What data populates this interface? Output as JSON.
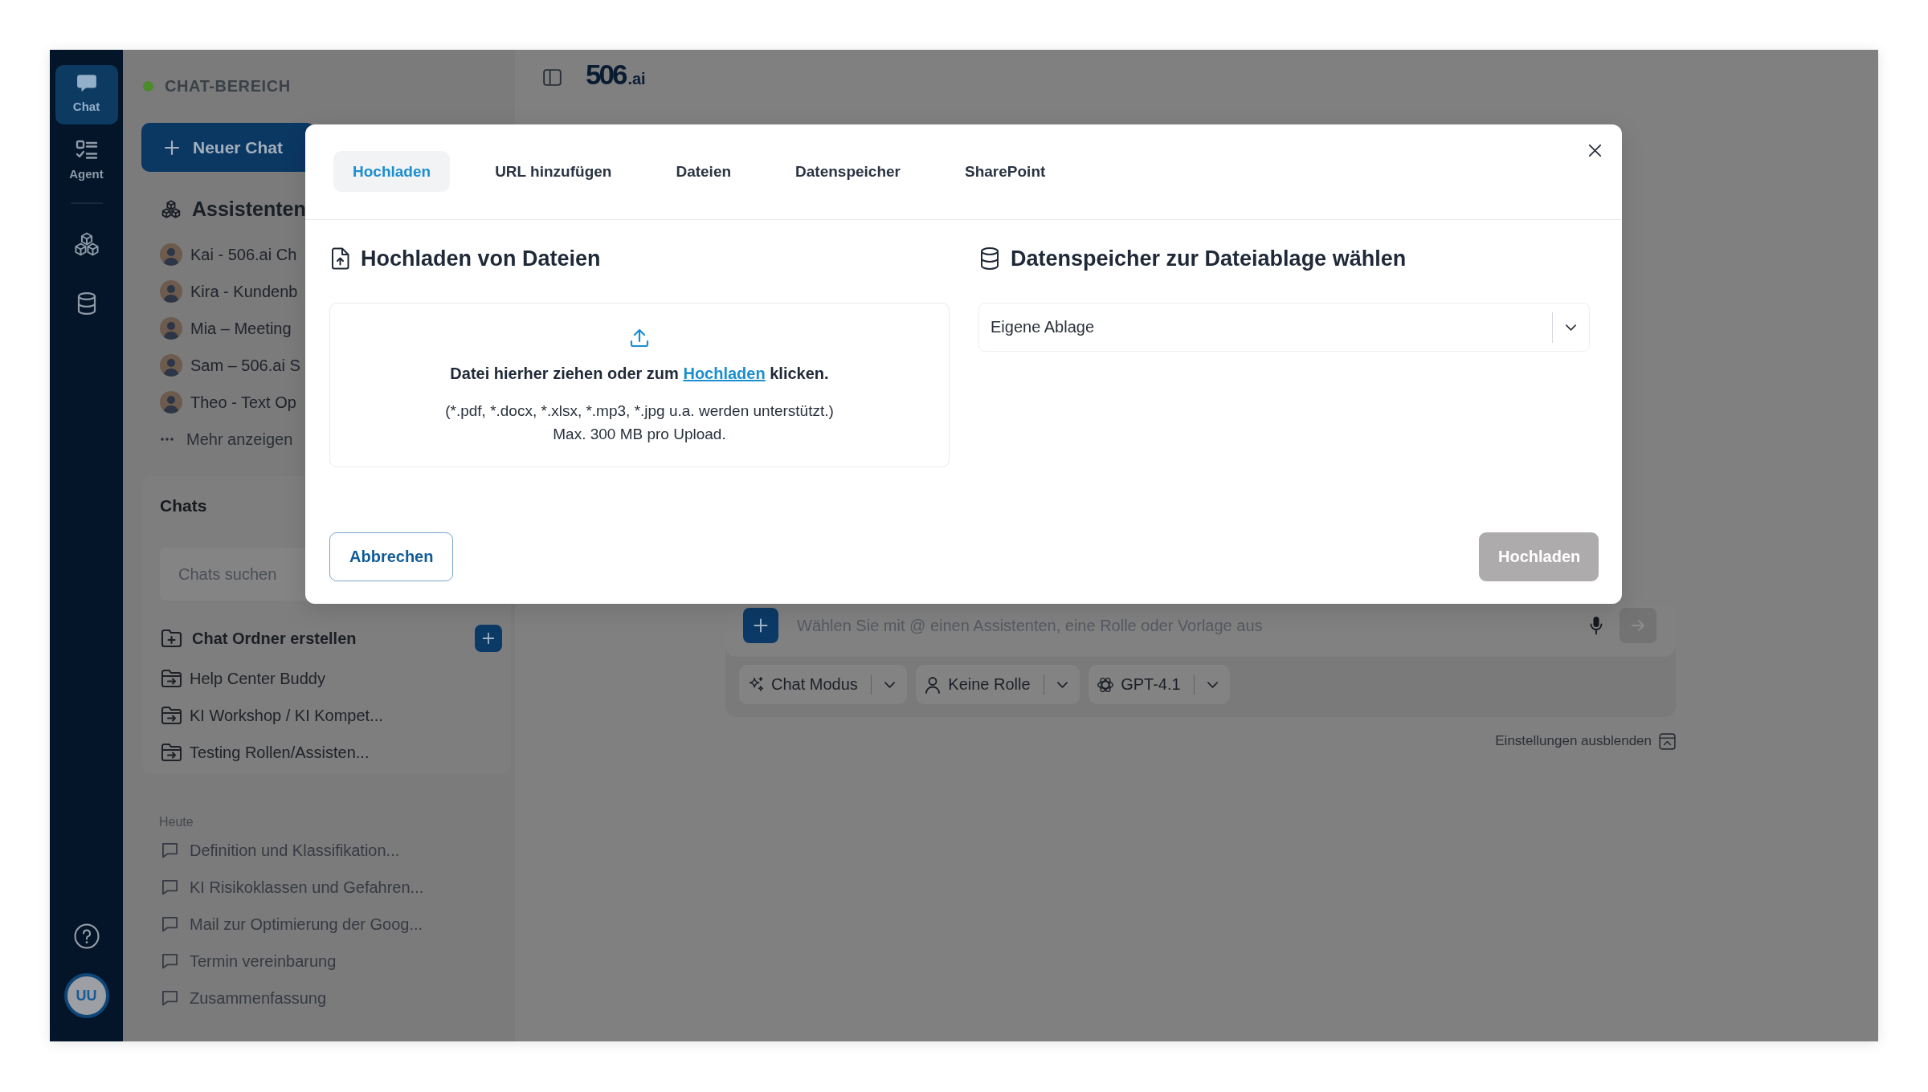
{
  "nav_rail": {
    "items": [
      {
        "kind": "chat",
        "label": "Chat",
        "selected": true
      },
      {
        "kind": "agent",
        "label": "Agent",
        "selected": false
      },
      {
        "kind": "cubes",
        "selected": false
      },
      {
        "kind": "database",
        "selected": false
      }
    ],
    "user_initials": "UU"
  },
  "sidebar": {
    "section_title": "CHAT-BEREICH",
    "new_chat": "Neuer Chat",
    "assistants": {
      "title": "Assistenten",
      "items": [
        "Kai - 506.ai Ch",
        "Kira - Kundenb",
        "Mia – Meeting",
        "Sam – 506.ai S",
        "Theo - Text Op"
      ],
      "more": "Mehr anzeigen"
    },
    "chats": {
      "title": "Chats",
      "search": {
        "placeholder": "Chats suchen"
      },
      "create_folder": "Chat Ordner erstellen",
      "folders": [
        "Help Center Buddy",
        "KI Workshop / KI Kompet...",
        "Testing Rollen/Assisten..."
      ]
    },
    "history": [
      {
        "label": "Heute",
        "items": [
          "Definition und Klassifikation...",
          "KI Risikoklassen und Gefahren...",
          "Mail zur Optimierung der Goog...",
          "Termin vereinbarung",
          "Zusammenfassung"
        ]
      }
    ]
  },
  "topbar": {
    "logo": {
      "mark": "506",
      "suffix": ".ai"
    }
  },
  "composer": {
    "placeholder": "Wählen Sie mit @ einen Assistenten, eine Rolle oder Vorlage aus",
    "send_enabled": false,
    "chips": [
      {
        "kind": "mode",
        "label": "Chat Modus"
      },
      {
        "kind": "role",
        "label": "Keine Rolle"
      },
      {
        "kind": "model",
        "label": "GPT-4.1"
      }
    ],
    "settings_toggle": "Einstellungen ausblenden"
  },
  "dialog": {
    "tabs": [
      {
        "label": "Hochladen",
        "selected": true
      },
      {
        "label": "URL hinzufügen",
        "selected": false
      },
      {
        "label": "Dateien",
        "selected": false
      },
      {
        "label": "Datenspeicher",
        "selected": false
      },
      {
        "label": "SharePoint",
        "selected": false
      }
    ],
    "upload": {
      "title": "Hochladen von Dateien",
      "prompt_before": "Datei hierher ziehen oder zum",
      "link": "Hochladen",
      "prompt_after": "klicken.",
      "formats": "(*.pdf, *.docx, *.xlsx, *.mp3, *.jpg u.a. werden unterstützt.)",
      "limit": "Max. 300 MB pro Upload."
    },
    "storage": {
      "title": "Datenspeicher zur Dateiablage wählen",
      "select": {
        "value": "Eigene Ablage"
      }
    },
    "buttons": [
      {
        "kind": "secondary",
        "label": "Abbrechen",
        "disabled": false
      },
      {
        "kind": "primary",
        "label": "Hochladen",
        "disabled": true
      }
    ]
  }
}
